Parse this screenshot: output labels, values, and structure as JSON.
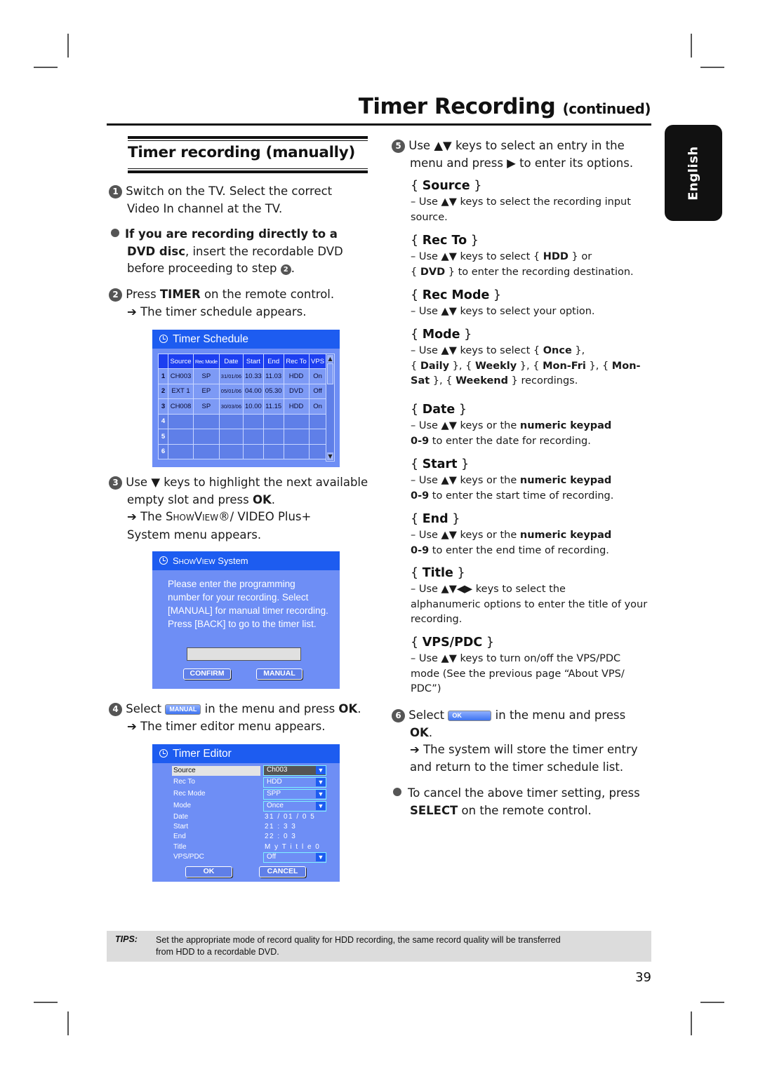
{
  "header": {
    "title": "Timer Recording",
    "title_suffix": "(continued)",
    "language_tab": "English"
  },
  "section": {
    "heading": "Timer recording (manually)"
  },
  "steps": {
    "s1": {
      "num": "1",
      "line1": "Switch on the TV. Select the correct",
      "line2": "Video In channel at the TV."
    },
    "note_dvd": {
      "bold1": "If you are recording directly to a",
      "bold2": "DVD disc",
      "rest2": ", insert the recordable DVD",
      "line3_a": "before proceeding to step ",
      "line3_num": "2",
      "line3_b": "."
    },
    "s2": {
      "num": "2",
      "pre": "Press ",
      "bold": "TIMER",
      "post": " on the remote control.",
      "result": "➔ The timer schedule appears."
    },
    "s3": {
      "num": "3",
      "line1": "Use ▼ keys to highlight the next available",
      "line2_a": "empty slot and press ",
      "line2_b": "OK",
      "line2_c": ".",
      "result_a": "➔ The S",
      "result_sc1": "HOW",
      "result_b": "V",
      "result_sc2": "IEW",
      "result_c": "®/ VIDEO Plus+",
      "line4": "System menu appears."
    },
    "s4": {
      "num": "4",
      "pre": "Select ",
      "button": "MANUAL",
      "post_a": " in the menu and press ",
      "post_b": "OK",
      "post_c": ".",
      "result": "➔ The timer editor menu appears."
    },
    "s5": {
      "num": "5",
      "line1": "Use ▲▼ keys to select an entry in the",
      "line2": "menu and press ▶ to enter its options."
    },
    "s6": {
      "num": "6",
      "pre": "Select ",
      "button": "OK",
      "post": " in the menu and press",
      "line2": "OK",
      "line2_end": ".",
      "result1": "➔ The system will store the timer entry",
      "result2": "and return to the timer schedule list."
    },
    "note_cancel": {
      "line1": "To cancel the above timer setting, press",
      "bold": "SELECT",
      "rest": " on the remote control."
    }
  },
  "options": [
    {
      "name": "Source",
      "lines": [
        "– Use ▲▼ keys to select the recording input",
        "source."
      ]
    },
    {
      "name": "Rec To",
      "lines": [
        "– Use ▲▼ keys to select { HDD } or",
        "{ DVD } to enter the recording destination."
      ]
    },
    {
      "name": "Rec Mode",
      "lines": [
        "– Use ▲▼ keys to select your option."
      ]
    },
    {
      "name": "Mode",
      "lines": [
        "–  Use ▲▼ keys to select { Once },",
        "{ Daily }, { Weekly }, { Mon-Fri }, { Mon-",
        "Sat }, { Weekend } recordings."
      ]
    },
    {
      "name": "Date",
      "lines": [
        "– Use ▲▼ keys or the numeric keypad",
        "0-9 to enter the date for recording."
      ]
    },
    {
      "name": "Start",
      "lines": [
        "– Use ▲▼ keys or the numeric keypad",
        "0-9 to enter the start time of recording."
      ]
    },
    {
      "name": "End",
      "lines": [
        "– Use ▲▼ keys or the numeric keypad",
        "0-9 to enter the end time of recording."
      ]
    },
    {
      "name": "Title",
      "lines": [
        "– Use ▲▼◀▶ keys to select the",
        "alphanumeric options to enter the title of your",
        "recording."
      ]
    },
    {
      "name": "VPS/PDC",
      "lines": [
        "– Use ▲▼ keys to turn on/off the VPS/PDC",
        "mode (See the previous page “About VPS/",
        "PDC”)"
      ]
    }
  ],
  "timer_schedule": {
    "title": "Timer Schedule",
    "columns": [
      "Source",
      "Rec Mode",
      "Date",
      "Start",
      "End",
      "Rec To",
      "VPS"
    ],
    "rows": [
      {
        "idx": "1",
        "cells": [
          "CH003",
          "SP",
          "31/01/06",
          "10.33",
          "11.03",
          "HDD",
          "On"
        ]
      },
      {
        "idx": "2",
        "cells": [
          "EXT 1",
          "EP",
          "05/01/06",
          "04.00",
          "05.30",
          "DVD",
          "Off"
        ]
      },
      {
        "idx": "3",
        "cells": [
          "CH008",
          "SP",
          "30/03/06",
          "10.00",
          "11.15",
          "HDD",
          "On"
        ]
      },
      {
        "idx": "4",
        "cells": [
          "",
          "",
          "",
          "",
          "",
          "",
          ""
        ]
      },
      {
        "idx": "5",
        "cells": [
          "",
          "",
          "",
          "",
          "",
          "",
          ""
        ]
      },
      {
        "idx": "6",
        "cells": [
          "",
          "",
          "",
          "",
          "",
          "",
          ""
        ]
      }
    ]
  },
  "showview": {
    "title_sc1": "S",
    "title_sc2": "HOW",
    "title_sc3": "V",
    "title_sc4": "IEW",
    "title_rest": " System",
    "lines": [
      "Please enter the programming",
      "number for your recording. Select",
      "[MANUAL] for manual timer recording.",
      "Press [BACK] to go to the timer list."
    ],
    "input_value": "",
    "confirm_label": "CONFIRM",
    "manual_label": "MANUAL"
  },
  "timer_editor": {
    "title": "Timer Editor",
    "fields": [
      {
        "label": "Source",
        "value": "Ch003",
        "dropdown": true
      },
      {
        "label": "Rec To",
        "value": "HDD",
        "dropdown": true
      },
      {
        "label": "Rec Mode",
        "value": "SPP",
        "dropdown": true
      },
      {
        "label": "Mode",
        "value": "Once",
        "dropdown": true
      },
      {
        "label": "Date",
        "value": "31 / 01 / 0 5",
        "dropdown": false
      },
      {
        "label": "Start",
        "value": "21 : 3 3",
        "dropdown": false
      },
      {
        "label": "End",
        "value": "22 : 0 3",
        "dropdown": false
      },
      {
        "label": "Title",
        "value": "M y T i t l e 0",
        "dropdown": false
      },
      {
        "label": "VPS/PDC",
        "value": "Off",
        "dropdown": true
      }
    ],
    "ok_label": "OK",
    "cancel_label": "CANCEL"
  },
  "tips": {
    "label": "TIPS:",
    "line1": "Set the appropriate mode of record quality for HDD recording, the same record quality will be transferred",
    "line2": "from HDD to a recordable DVD."
  },
  "page_number": "39",
  "colors": {
    "osd_panel": "#6e8ef5",
    "osd_titlebar": "#1d5cf0",
    "tips_bg": "#dcdcdc",
    "lang_tab": "#111111"
  }
}
